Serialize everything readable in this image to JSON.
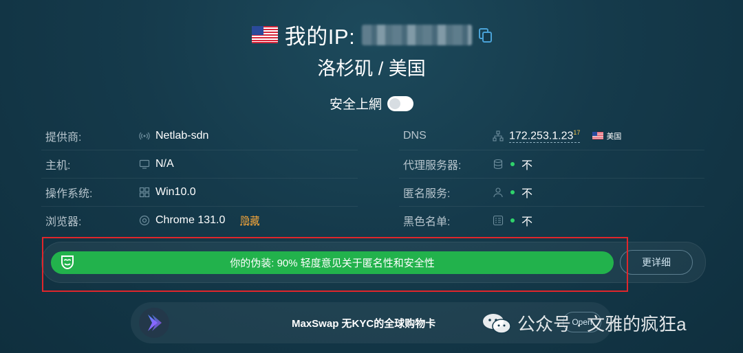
{
  "header": {
    "ip_label": "我的IP:",
    "location": "洛杉矶 / 美国",
    "safe_browsing_label": "安全上網"
  },
  "info_left": [
    {
      "label": "提供商:",
      "value": "Netlab-sdn",
      "icon": "signal-icon"
    },
    {
      "label": "主机:",
      "value": "N/A",
      "icon": "monitor-icon"
    },
    {
      "label": "操作系统:",
      "value": "Win10.0",
      "icon": "windows-icon"
    },
    {
      "label": "浏览器:",
      "value": "Chrome 131.0",
      "icon": "chrome-icon",
      "extra": "隐藏"
    }
  ],
  "info_right": [
    {
      "label": "DNS",
      "value": "172.253.1.23",
      "sup": "17",
      "country": "美国",
      "icon": "network-icon"
    },
    {
      "label": "代理服务器:",
      "value": "不",
      "icon": "database-icon"
    },
    {
      "label": "匿名服务:",
      "value": "不",
      "icon": "user-icon"
    },
    {
      "label": "黑色名单:",
      "value": "不",
      "icon": "list-icon"
    }
  ],
  "disguise": {
    "text": "你的伪装: 90% 轻度意见关于匿名性和安全性",
    "percent": 90,
    "more_label": "更详细"
  },
  "ad": {
    "text": "MaxSwap 无KYC的全球购物卡",
    "open_label": "Open"
  },
  "watermark": {
    "text": "公众号 · 文雅的疯狂a"
  },
  "colors": {
    "accent_green": "#22b24c",
    "highlight_red": "#e0262b",
    "hide_orange": "#f0a33a",
    "bg": "#153a4b"
  }
}
